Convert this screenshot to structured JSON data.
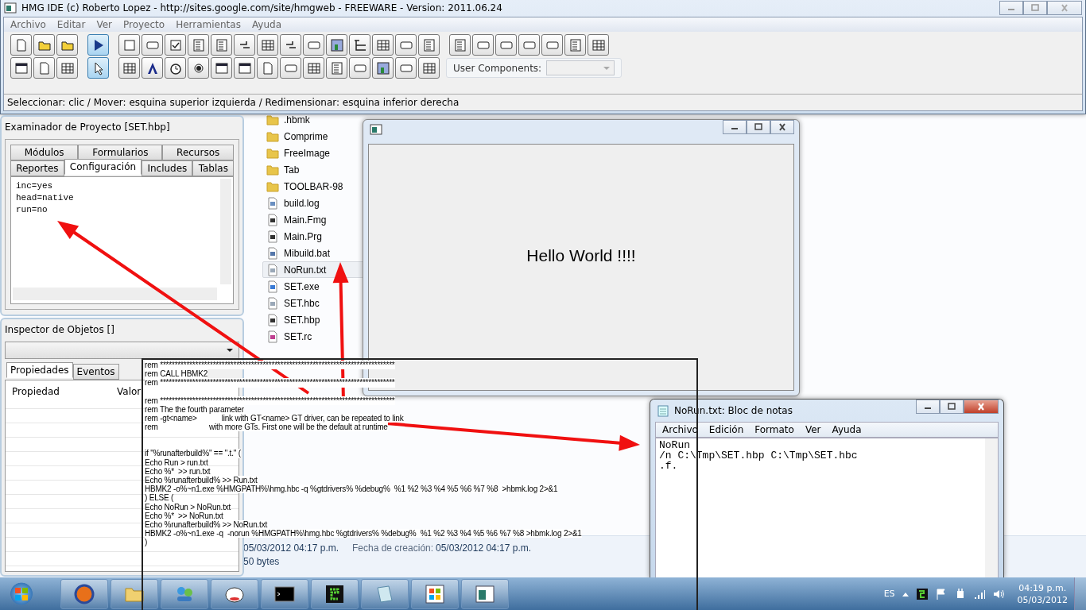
{
  "ide_window": {
    "title": "HMG IDE (c) Roberto Lopez - http://sites.google.com/site/hmgweb - FREEWARE - Version: 2011.06.24",
    "menu": [
      "Archivo",
      "Editar",
      "Ver",
      "Proyecto",
      "Herramientas",
      "Ayuda"
    ],
    "toolbar_rows": [
      [
        [
          {
            "selected": false
          },
          {
            "selected": false
          },
          {
            "selected": false
          }
        ],
        [
          {
            "selected": true
          }
        ],
        [
          {
            "selected": false
          },
          {
            "selected": false
          },
          {
            "selected": false
          },
          {
            "selected": false
          },
          {
            "selected": false
          },
          {
            "selected": false
          },
          {
            "selected": false
          },
          {
            "selected": false
          },
          {
            "selected": false
          },
          {
            "selected": false
          },
          {
            "selected": false
          },
          {
            "selected": false
          },
          {
            "selected": false
          },
          {
            "selected": false
          }
        ],
        [
          {
            "selected": false
          },
          {
            "selected": false
          },
          {
            "selected": false
          },
          {
            "selected": false
          },
          {
            "selected": false
          },
          {
            "selected": false
          },
          {
            "selected": false
          }
        ]
      ],
      [
        [
          {
            "selected": false
          },
          {
            "selected": false
          },
          {
            "selected": false
          }
        ],
        [
          {
            "selected": true
          }
        ],
        [
          {
            "selected": false
          },
          {
            "selected": false
          },
          {
            "selected": false
          },
          {
            "selected": false
          },
          {
            "selected": false
          },
          {
            "selected": false
          },
          {
            "selected": false
          },
          {
            "selected": false
          },
          {
            "selected": false
          },
          {
            "selected": false
          },
          {
            "selected": false
          },
          {
            "selected": false
          },
          {
            "selected": false
          },
          {
            "selected": false
          }
        ]
      ]
    ],
    "user_components_label": "User Components:",
    "status_bar": "Seleccionar: clic / Mover: esquina superior izquierda / Redimensionar: esquina inferior derecha"
  },
  "project_browser": {
    "title": "Examinador de Proyecto [SET.hbp]",
    "tab_rows": [
      [
        {
          "label": "Módulos",
          "selected": false
        },
        {
          "label": "Formularios",
          "selected": false
        },
        {
          "label": "Recursos",
          "selected": false
        }
      ],
      [
        {
          "label": "Reportes",
          "selected": false
        },
        {
          "label": "Configuración",
          "selected": true
        },
        {
          "label": "Includes",
          "selected": false
        },
        {
          "label": "Tablas",
          "selected": false
        }
      ]
    ],
    "config_lines": [
      "inc=yes",
      "head=native",
      "run=no"
    ]
  },
  "object_inspector": {
    "title": "Inspector de Objetos []",
    "tabs": [
      {
        "label": "Propiedades",
        "selected": true
      },
      {
        "label": "Eventos",
        "selected": false
      }
    ],
    "columns": [
      "Propiedad",
      "Valor"
    ]
  },
  "file_list": [
    {
      "name": ".hbmk",
      "kind": "folder",
      "selected": false
    },
    {
      "name": "Comprime",
      "kind": "folder",
      "selected": false
    },
    {
      "name": "FreeImage",
      "kind": "folder",
      "selected": false
    },
    {
      "name": "Tab",
      "kind": "folder",
      "selected": false
    },
    {
      "name": "TOOLBAR-98",
      "kind": "folder",
      "selected": false
    },
    {
      "name": "build.log",
      "kind": "log",
      "selected": false
    },
    {
      "name": "Main.Fmg",
      "kind": "source",
      "selected": false
    },
    {
      "name": "Main.Prg",
      "kind": "source",
      "selected": false
    },
    {
      "name": "Mibuild.bat",
      "kind": "batch",
      "selected": false
    },
    {
      "name": "NoRun.txt",
      "kind": "text",
      "selected": true
    },
    {
      "name": "SET.exe",
      "kind": "program",
      "selected": false
    },
    {
      "name": "SET.hbc",
      "kind": "text",
      "selected": false
    },
    {
      "name": "SET.hbp",
      "kind": "source",
      "selected": false
    },
    {
      "name": "SET.rc",
      "kind": "resource",
      "selected": false
    }
  ],
  "file_details": {
    "modified": "05/03/2012 04:17 p.m.",
    "created_label": "Fecha de creación:",
    "created": "05/03/2012 04:17 p.m.",
    "size": "50 bytes"
  },
  "hello_window": {
    "message": "Hello World !!!!"
  },
  "batch_listing": {
    "blocks": [
      [
        "rem ********************************************************************************",
        "rem CALL HBMK2",
        "rem ********************************************************************************"
      ],
      [
        "rem ********************************************************************************",
        "rem The the fourth parameter",
        "rem -gt<name>            link with GT<name> GT driver, can be repeated to link",
        "rem                         with more GTs. First one will be the default at runtime"
      ],
      [
        "if \"%runafterbuild%\" == \".t.\" (",
        "Echo Run > run.txt",
        "Echo %*  >> run.txt",
        "Echo %runafterbuild% >> Run.txt",
        "HBMK2 -o%~n1.exe %HMGPATH%\\hmg.hbc -q %gtdrivers% %debug%  %1 %2 %3 %4 %5 %6 %7 %8  >hbmk.log 2>&1",
        ") ELSE (",
        "Echo NoRun > NoRun.txt",
        "Echo %*  >> NoRun.txt",
        "Echo %runafterbuild% >> NoRun.txt",
        "HBMK2 -o%~n1.exe -q  -norun %HMGPATH%\\hmg.hbc %gtdrivers% %debug%  %1 %2 %3 %4 %5 %6 %7 %8 >hbmk.log 2>&1",
        ")"
      ]
    ]
  },
  "notepad": {
    "title": "NoRun.txt: Bloc de notas",
    "menu": [
      "Archivo",
      "Edición",
      "Formato",
      "Ver",
      "Ayuda"
    ],
    "lines": [
      "NoRun",
      "/n C:\\Tmp\\SET.hbp C:\\Tmp\\SET.hbc",
      ".f."
    ]
  },
  "taskbar": {
    "language": "ES",
    "time": "04:19 p.m.",
    "date": "05/03/2012"
  }
}
